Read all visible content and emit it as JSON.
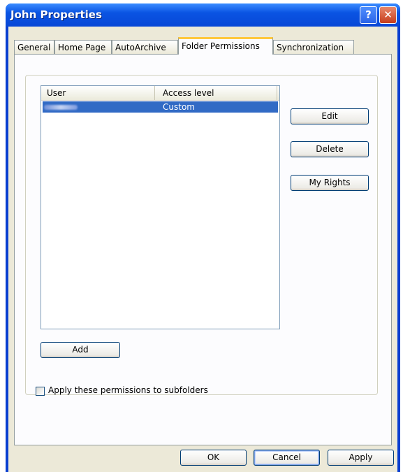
{
  "window": {
    "title": "John Properties",
    "help_glyph": "?",
    "close_glyph": "✕"
  },
  "tabs": [
    {
      "label": "General"
    },
    {
      "label": "Home Page"
    },
    {
      "label": "AutoArchive"
    },
    {
      "label": "Folder Permissions",
      "active": true
    },
    {
      "label": "Synchronization"
    }
  ],
  "permissions_list": {
    "columns": [
      "User",
      "Access level"
    ],
    "rows": [
      {
        "user": "",
        "access_level": "Custom",
        "selected": true
      }
    ]
  },
  "buttons": {
    "edit": "Edit",
    "delete": "Delete",
    "my_rights": "My Rights",
    "add": "Add",
    "ok": "OK",
    "cancel": "Cancel",
    "apply": "Apply"
  },
  "subfolders_checkbox": {
    "label": "Apply these permissions to subfolders",
    "checked": false
  },
  "colors": {
    "titlebar": "#0a54e3",
    "selection": "#316ac5",
    "active_tab_accent": "#ffc83c",
    "dialog_bg": "#ece9d8"
  }
}
